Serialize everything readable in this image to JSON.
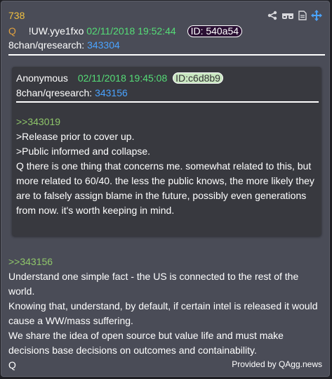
{
  "post": {
    "number": "738",
    "q_marker": "Q",
    "tripcode": "!UW.yye1fxo",
    "date": "02/11/2018 19:52:44",
    "id": "ID: 540a54",
    "source_label": "8chan/qresearch:",
    "source_link": "343304"
  },
  "toolbar": {
    "icons": [
      "share-icon",
      "glasses-icon",
      "document-icon",
      "move-icon"
    ],
    "accent": "#4aa3ff"
  },
  "quoted": {
    "author": "Anonymous",
    "date": "02/11/2018 19:45:08",
    "id": "ID:c6d8b9",
    "source_label": "8chan/qresearch:",
    "source_link": "343156",
    "lines": [
      {
        "text": ">>343019",
        "type": "greentext"
      },
      {
        "text": ">Release prior to cover up.",
        "type": "plain"
      },
      {
        "text": ">Public informed and collapse.",
        "type": "plain"
      },
      {
        "text": "Q there is one thing that concerns me.  somewhat related to this, but more related to 60/40.  the less the public knows, the more likely they are to falsely assign blame in the future, possibly even generations from now.  it's worth keeping in mind.",
        "type": "plain"
      }
    ]
  },
  "body": {
    "lines": [
      {
        "text": ">>343156",
        "type": "greentext"
      },
      {
        "text": "Understand one simple fact - the US is connected to the rest of the world.",
        "type": "plain"
      },
      {
        "text": "Knowing that, understand, by default, if certain intel is released it would cause a WW/mass suffering.",
        "type": "plain"
      },
      {
        "text": "We share the idea of open source but value life and must make decisions base decisions on outcomes and containability.",
        "type": "plain"
      },
      {
        "text": "Q",
        "type": "plain"
      }
    ]
  },
  "footer": {
    "text": "Provided by QAgg.news"
  },
  "colors": {
    "card_bg": "#4a4c57",
    "quote_bg": "#38393f",
    "post_number": "#f0c040",
    "date": "#55dd77",
    "link": "#4aa3ff",
    "greentext": "#8fc66a"
  }
}
